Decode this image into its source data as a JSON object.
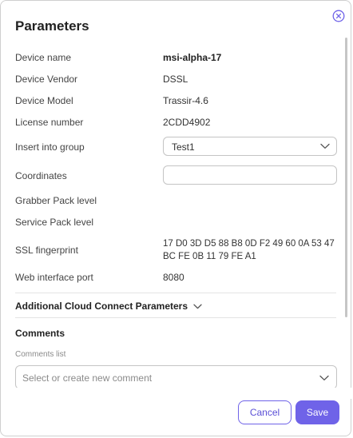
{
  "dialog": {
    "title": "Parameters",
    "close_icon": "close-circle-icon"
  },
  "rows": {
    "device_name": {
      "label": "Device name",
      "value": "msi-alpha-17"
    },
    "device_vendor": {
      "label": "Device Vendor",
      "value": "DSSL"
    },
    "device_model": {
      "label": "Device Model",
      "value": "Trassir-4.6"
    },
    "license_number": {
      "label": "License number",
      "value": "2CDD4902"
    },
    "insert_group": {
      "label": "Insert into group",
      "value": "Test1"
    },
    "coordinates": {
      "label": "Coordinates",
      "value": ""
    },
    "grabber_pack": {
      "label": "Grabber Pack level",
      "value": ""
    },
    "service_pack": {
      "label": "Service Pack level",
      "value": ""
    },
    "ssl_fingerprint": {
      "label": "SSL fingerprint",
      "line1": "17 D0 3D D5 88 B8 0D F2 49 60 0A 53 47",
      "line2": "BC FE 0B 11 79 FE A1"
    },
    "web_port": {
      "label": "Web interface port",
      "value": "8080"
    }
  },
  "cloud_section": {
    "label": "Additional Cloud Connect Parameters"
  },
  "comments": {
    "title": "Comments",
    "list_label": "Comments list",
    "placeholder": "Select or create new comment"
  },
  "buttons": {
    "cancel": "Cancel",
    "save": "Save"
  },
  "colors": {
    "accent": "#6f63e8",
    "border": "#c4c4c4"
  }
}
